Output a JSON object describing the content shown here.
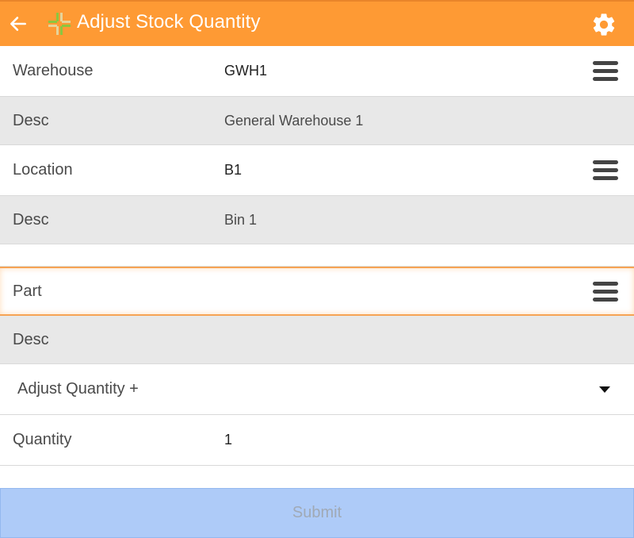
{
  "header": {
    "title": "Adjust Stock Quantity",
    "back_icon": "arrow-left-icon",
    "logo_icon": "app-logo-cross-icon",
    "settings_icon": "gear-icon",
    "background_color": "#fe9a34"
  },
  "form": {
    "warehouse": {
      "label": "Warehouse",
      "value": "GWH1",
      "menu_icon": "hamburger-menu-icon"
    },
    "warehouse_desc": {
      "label": "Desc",
      "value": "General Warehouse 1"
    },
    "location": {
      "label": "Location",
      "value": "B1",
      "menu_icon": "hamburger-menu-icon"
    },
    "location_desc": {
      "label": "Desc",
      "value": "Bin 1"
    },
    "part": {
      "label": "Part",
      "value": "",
      "menu_icon": "hamburger-menu-icon",
      "focused": true,
      "focus_color": "#f6a354"
    },
    "part_desc": {
      "label": "Desc",
      "value": ""
    },
    "adjust_type": {
      "selected": "Adjust Quantity +",
      "dropdown_icon": "caret-down-icon"
    },
    "quantity": {
      "label": "Quantity",
      "value": "1"
    }
  },
  "submit": {
    "label": "Submit",
    "enabled": false,
    "color": "#aecbf8"
  }
}
